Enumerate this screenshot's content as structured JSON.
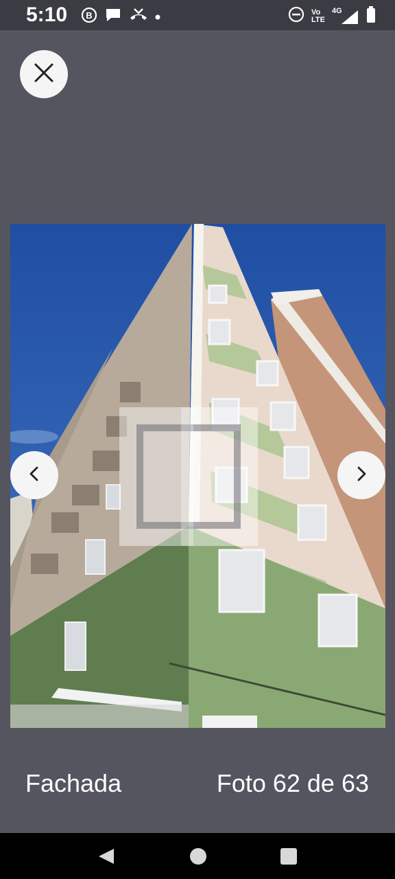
{
  "status_bar": {
    "time": "5:10",
    "left_icons": [
      "b-icon",
      "chat-bubble-icon",
      "missed-call-icon",
      "dot-icon"
    ],
    "right_icons": [
      "do-not-disturb-icon",
      "volte-icon",
      "signal-4g-icon",
      "battery-icon"
    ],
    "volte_top": "Vo",
    "volte_bottom": "LTE",
    "network": "4G"
  },
  "viewer": {
    "close_label": "Close",
    "caption": "Fachada",
    "counter": "Foto 62 de 63"
  },
  "colors": {
    "background": "#55555f",
    "status_bar": "#3b3b44",
    "button_bg": "#f5f5f5",
    "sky": "#2f5fae"
  }
}
